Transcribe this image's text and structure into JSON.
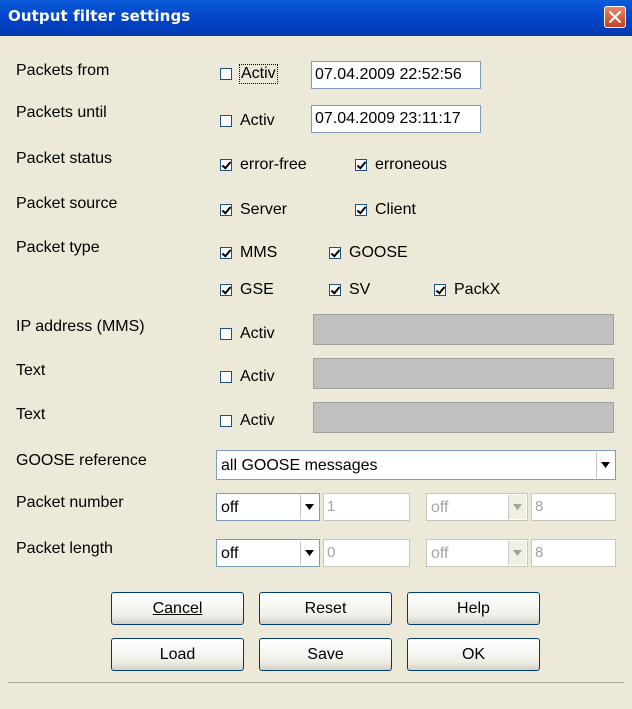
{
  "window": {
    "title": "Output filter settings"
  },
  "rows": {
    "packets_from": {
      "label": "Packets from",
      "checkbox": "Activ",
      "checked": false,
      "value": "07.04.2009 22:52:56"
    },
    "packets_until": {
      "label": "Packets until",
      "checkbox": "Activ",
      "checked": false,
      "value": "07.04.2009 23:11:17"
    },
    "packet_status": {
      "label": "Packet status",
      "options": [
        {
          "label": "error-free",
          "checked": true
        },
        {
          "label": "erroneous",
          "checked": true
        }
      ]
    },
    "packet_source": {
      "label": "Packet source",
      "options": [
        {
          "label": "Server",
          "checked": true
        },
        {
          "label": "Client",
          "checked": true
        }
      ]
    },
    "packet_type": {
      "label": "Packet type",
      "options": [
        {
          "label": "MMS",
          "checked": true
        },
        {
          "label": "GOOSE",
          "checked": true
        },
        {
          "label": "GSE",
          "checked": true
        },
        {
          "label": "SV",
          "checked": true
        },
        {
          "label": "PackX",
          "checked": true
        }
      ]
    },
    "ip_address": {
      "label": "IP address (MMS)",
      "checkbox": "Activ",
      "checked": false,
      "value": ""
    },
    "text1": {
      "label": "Text",
      "checkbox": "Activ",
      "checked": false,
      "value": ""
    },
    "text2": {
      "label": "Text",
      "checkbox": "Activ",
      "checked": false,
      "value": ""
    },
    "goose_reference": {
      "label": "GOOSE reference",
      "value": "all GOOSE messages"
    },
    "packet_number": {
      "label": "Packet number",
      "select1": "off",
      "value1": "1",
      "select2": "off",
      "value2": "8"
    },
    "packet_length": {
      "label": "Packet length",
      "select1": "off",
      "value1": "0",
      "select2": "off",
      "value2": "8"
    }
  },
  "buttons": {
    "cancel": "Cancel",
    "reset": "Reset",
    "help": "Help",
    "load": "Load",
    "save": "Save",
    "ok": "OK"
  },
  "colors": {
    "titlebar": "#0A5BD8",
    "dialog_bg": "#ECE9D8",
    "disabled_field": "#C0C0C0"
  }
}
